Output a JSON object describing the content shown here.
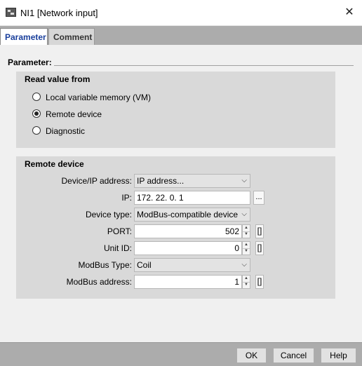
{
  "window": {
    "title": "NI1 [Network input]",
    "close_symbol": "✕"
  },
  "tabs": [
    {
      "label": "Parameter",
      "active": true
    },
    {
      "label": "Comment",
      "active": false
    }
  ],
  "parameter_section": {
    "label": "Parameter:"
  },
  "read_value_from": {
    "title": "Read value from",
    "options": [
      {
        "label": "Local variable memory (VM)",
        "checked": false
      },
      {
        "label": "Remote device",
        "checked": true
      },
      {
        "label": "Diagnostic",
        "checked": false
      }
    ]
  },
  "remote_device": {
    "title": "Remote device",
    "device_ip_address": {
      "label": "Device/IP address:",
      "value": "IP address..."
    },
    "ip": {
      "label": "IP:",
      "value": "172. 22.  0.  1",
      "browse_label": "..."
    },
    "device_type": {
      "label": "Device type:",
      "value": "ModBus-compatible device"
    },
    "port": {
      "label": "PORT:",
      "value": "502"
    },
    "unit_id": {
      "label": "Unit ID:",
      "value": "0"
    },
    "modbus_type": {
      "label": "ModBus Type:",
      "value": "Coil"
    },
    "modbus_address": {
      "label": "ModBus address:",
      "value": "1"
    },
    "bracket_symbol": "[]"
  },
  "buttons": {
    "ok": "OK",
    "cancel": "Cancel",
    "help": "Help"
  },
  "icons": {
    "chevron": "⌵",
    "spin_up": "▲",
    "spin_down": "▼"
  },
  "colors": {
    "active_tab_text": "#1a3f9c",
    "group_background": "#d9d9d9",
    "bar_background": "#acacac"
  }
}
